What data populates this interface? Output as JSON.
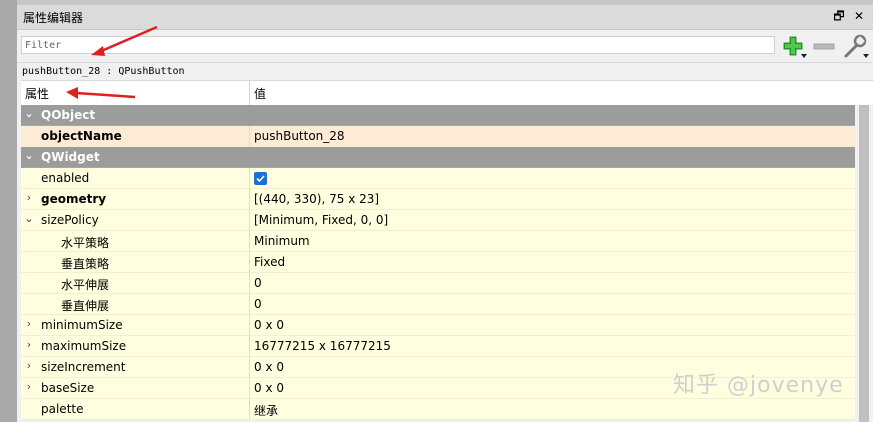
{
  "panel": {
    "title": "属性编辑器",
    "float_label": "🗗",
    "close_label": "✕"
  },
  "filter": {
    "placeholder": "Filter"
  },
  "tools": {
    "add_icon": "plus-icon",
    "remove_icon": "minus-icon",
    "configure_icon": "wrench-icon"
  },
  "object_line": "pushButton_28 : QPushButton",
  "header": {
    "property": "属性",
    "value": "值"
  },
  "rows": [
    {
      "type": "group",
      "name": "QObject",
      "expanded": true
    },
    {
      "type": "prop",
      "name": "objectName",
      "value": "pushButton_28",
      "bold": true,
      "selected": true
    },
    {
      "type": "group",
      "name": "QWidget",
      "expanded": true
    },
    {
      "type": "prop",
      "name": "enabled",
      "checkbox": true,
      "checked": true
    },
    {
      "type": "prop",
      "name": "geometry",
      "value": "[(440, 330), 75 x 23]",
      "bold": true,
      "expander": "collapsed"
    },
    {
      "type": "prop",
      "name": "sizePolicy",
      "value": "[Minimum, Fixed, 0, 0]",
      "expander": "expanded"
    },
    {
      "type": "prop",
      "name": "水平策略",
      "value": "Minimum",
      "child": true
    },
    {
      "type": "prop",
      "name": "垂直策略",
      "value": "Fixed",
      "child": true
    },
    {
      "type": "prop",
      "name": "水平伸展",
      "value": "0",
      "child": true
    },
    {
      "type": "prop",
      "name": "垂直伸展",
      "value": "0",
      "child": true
    },
    {
      "type": "prop",
      "name": "minimumSize",
      "value": "0 x 0",
      "expander": "collapsed"
    },
    {
      "type": "prop",
      "name": "maximumSize",
      "value": "16777215 x 16777215",
      "expander": "collapsed"
    },
    {
      "type": "prop",
      "name": "sizeIncrement",
      "value": "0 x 0",
      "expander": "collapsed"
    },
    {
      "type": "prop",
      "name": "baseSize",
      "value": "0 x 0",
      "expander": "collapsed"
    },
    {
      "type": "prop",
      "name": "palette",
      "value": "继承"
    }
  ],
  "watermark": "知乎 @jovenye",
  "colors": {
    "group_bg": "#9c9c9c",
    "prop_bg": "#ffffdf",
    "selected_bg": "#fdebd6",
    "annotation_arrow": "#e02020"
  }
}
